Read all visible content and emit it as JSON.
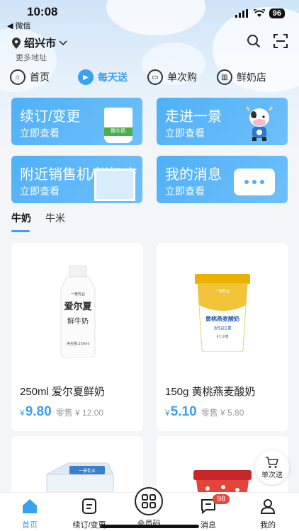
{
  "status_bar": {
    "time": "10:08",
    "back_label": "◀ 微信",
    "battery": "96"
  },
  "header": {
    "city": "绍兴市",
    "more_address": "更多地址",
    "icons": [
      "search-icon",
      "scan-icon"
    ]
  },
  "top_tabs": [
    {
      "label": "首页",
      "icon": "home-icon",
      "active": false
    },
    {
      "label": "每天送",
      "icon": "delivery-icon",
      "active": true
    },
    {
      "label": "单次购",
      "icon": "bag-icon",
      "active": false
    },
    {
      "label": "鲜奶店",
      "icon": "store-icon",
      "active": false
    }
  ],
  "cards": [
    {
      "title": "续订/变更",
      "subtitle": "立即查看",
      "illustration_text": "酸牛奶"
    },
    {
      "title": "走进一景",
      "subtitle": "立即查看"
    },
    {
      "title": "附近销售机/鲜奶店",
      "subtitle": "立即查看"
    },
    {
      "title": "我的消息",
      "subtitle": "立即查看"
    }
  ],
  "category_tabs": [
    {
      "label": "牛奶",
      "active": true
    },
    {
      "label": "牛米",
      "active": false
    }
  ],
  "products": [
    {
      "name": "250ml 爱尔夏鲜奶",
      "currency": "¥",
      "price": "9.80",
      "retail": "零售 ¥ 12.00",
      "bottle_text": [
        "一景乳业",
        "爱尔夏",
        "鲜牛奶",
        "净含量:250ml"
      ]
    },
    {
      "name": "150g 黄桃燕麦酸奶",
      "currency": "¥",
      "price": "5.10",
      "retail": "零售 ¥ 5.80",
      "cup_text": [
        "一景乳业",
        "黄桃燕麦酸奶",
        "活性益生菌",
        "4C冷藏"
      ]
    }
  ],
  "partial_products": [
    {
      "label": "一景乳业"
    },
    {
      "label": ""
    }
  ],
  "float_button": {
    "label": "单次送",
    "icon": "cart-icon"
  },
  "bottom_nav": [
    {
      "label": "首页",
      "icon": "home-icon",
      "active": true
    },
    {
      "label": "续订/变更",
      "icon": "document-icon",
      "active": false
    },
    {
      "label": "会员码",
      "icon": "member-code-icon",
      "active": false
    },
    {
      "label": "消息",
      "icon": "message-icon",
      "active": false,
      "badge": "98"
    },
    {
      "label": "我的",
      "icon": "profile-icon",
      "active": false
    }
  ],
  "colors": {
    "accent": "#3aa0f0",
    "card": "#4fb0f6",
    "badge": "#e8453c",
    "background": "#f4f5f7"
  }
}
